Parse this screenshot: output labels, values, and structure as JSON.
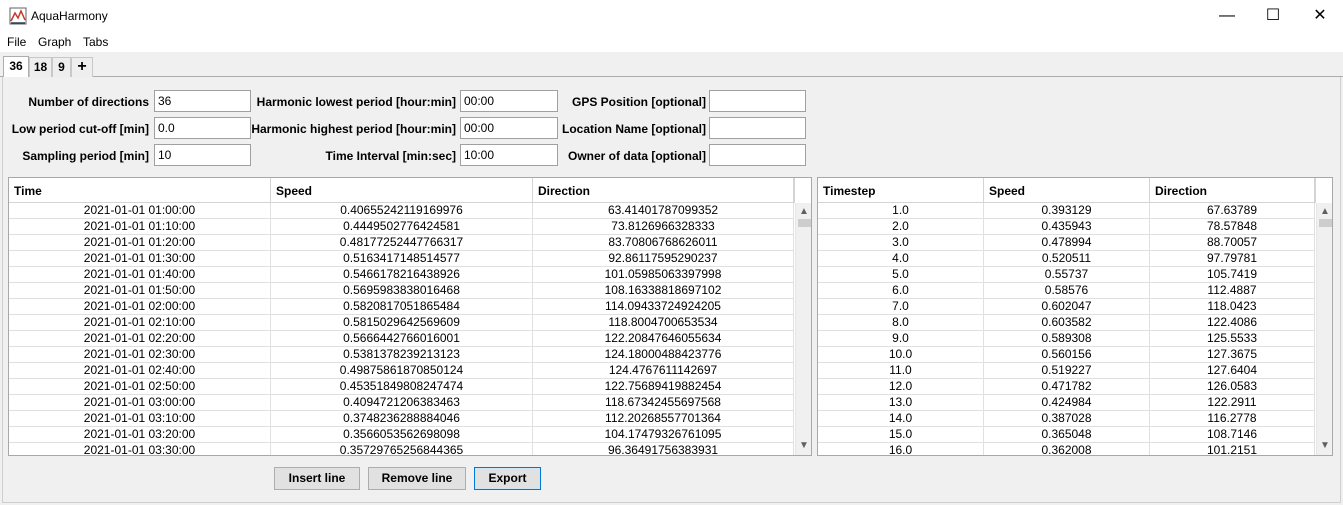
{
  "window": {
    "title": "AquaHarmony",
    "min_glyph": "—",
    "max_glyph": "☐",
    "close_glyph": "✕"
  },
  "menu": {
    "file": "File",
    "graph": "Graph",
    "tabs": "Tabs"
  },
  "tabs": [
    {
      "label": "36",
      "active": true
    },
    {
      "label": "18"
    },
    {
      "label": "9"
    },
    {
      "label": "+"
    }
  ],
  "form": {
    "num_directions": {
      "label": "Number of directions",
      "value": "36"
    },
    "low_cutoff": {
      "label": "Low period cut-off [min]",
      "value": "0.0"
    },
    "sampling_period": {
      "label": "Sampling period [min]",
      "value": "10"
    },
    "harmonic_lowest": {
      "label": "Harmonic lowest period [hour:min]",
      "value": "00:00"
    },
    "harmonic_highest": {
      "label": "Harmonic highest period [hour:min]",
      "value": "00:00"
    },
    "time_interval": {
      "label": "Time Interval [min:sec]",
      "value": "10:00"
    },
    "gps_position": {
      "label": "GPS Position [optional]",
      "value": ""
    },
    "location_name": {
      "label": "Location Name [optional]",
      "value": ""
    },
    "owner": {
      "label": "Owner of data [optional]",
      "value": ""
    }
  },
  "left_table": {
    "columns": [
      "Time",
      "Speed",
      "Direction"
    ],
    "rows": [
      [
        "2021-01-01 01:00:00",
        "0.40655242119169976",
        "63.41401787099352"
      ],
      [
        "2021-01-01 01:10:00",
        "0.4449502776424581",
        "73.8126966328333"
      ],
      [
        "2021-01-01 01:20:00",
        "0.48177252447766317",
        "83.70806768626011"
      ],
      [
        "2021-01-01 01:30:00",
        "0.5163417148514577",
        "92.86117595290237"
      ],
      [
        "2021-01-01 01:40:00",
        "0.5466178216438926",
        "101.05985063397998"
      ],
      [
        "2021-01-01 01:50:00",
        "0.5695983838016468",
        "108.16338818697102"
      ],
      [
        "2021-01-01 02:00:00",
        "0.5820817051865484",
        "114.09433724924205"
      ],
      [
        "2021-01-01 02:10:00",
        "0.5815029642569609",
        "118.8004700653534"
      ],
      [
        "2021-01-01 02:20:00",
        "0.5666442766016001",
        "122.20847646055634"
      ],
      [
        "2021-01-01 02:30:00",
        "0.5381378239213123",
        "124.18000488423776"
      ],
      [
        "2021-01-01 02:40:00",
        "0.49875861870850124",
        "124.4767611142697"
      ],
      [
        "2021-01-01 02:50:00",
        "0.45351849808247474",
        "122.75689419882454"
      ],
      [
        "2021-01-01 03:00:00",
        "0.4094721206383463",
        "118.67342455697568"
      ],
      [
        "2021-01-01 03:10:00",
        "0.3748236288884046",
        "112.20268557701364"
      ],
      [
        "2021-01-01 03:20:00",
        "0.3566053562698098",
        "104.17479326761095"
      ],
      [
        "2021-01-01 03:30:00",
        "0.35729765256844365",
        "96.36491756383931"
      ]
    ]
  },
  "right_table": {
    "columns": [
      "Timestep",
      "Speed",
      "Direction"
    ],
    "rows": [
      [
        "1.0",
        "0.393129",
        "67.63789"
      ],
      [
        "2.0",
        "0.435943",
        "78.57848"
      ],
      [
        "3.0",
        "0.478994",
        "88.70057"
      ],
      [
        "4.0",
        "0.520511",
        "97.79781"
      ],
      [
        "5.0",
        "0.55737",
        "105.7419"
      ],
      [
        "6.0",
        "0.58576",
        "112.4887"
      ],
      [
        "7.0",
        "0.602047",
        "118.0423"
      ],
      [
        "8.0",
        "0.603582",
        "122.4086"
      ],
      [
        "9.0",
        "0.589308",
        "125.5533"
      ],
      [
        "10.0",
        "0.560156",
        "127.3675"
      ],
      [
        "11.0",
        "0.519227",
        "127.6404"
      ],
      [
        "12.0",
        "0.471782",
        "126.0583"
      ],
      [
        "13.0",
        "0.424984",
        "122.2911"
      ],
      [
        "14.0",
        "0.387028",
        "116.2778"
      ],
      [
        "15.0",
        "0.365048",
        "108.7146"
      ],
      [
        "16.0",
        "0.362008",
        "101.2151"
      ]
    ]
  },
  "buttons": {
    "insert": "Insert line",
    "remove": "Remove line",
    "export": "Export"
  }
}
